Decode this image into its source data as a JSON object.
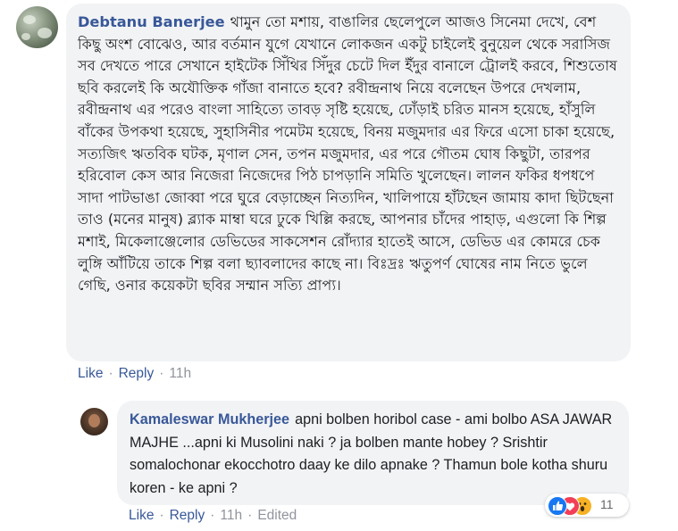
{
  "comment": {
    "author": "Debtanu Banerjee",
    "body": "থামুন তো মশায়, বাঙালির ছেলেপুলে আজও সিনেমা দেখে, বেশ কিছু অংশ বোঝেও, আর বর্তমান যুগে যেখানে লোকজন একটু চাইলেই বুনুয়েল থেকে সরাসিজ সব দেখতে পারে সেখানে হাইটেক সিঁথির সিঁদুর চেটে দিল ইঁদুর বানালে ট্রোলই করবে, শিশুতোষ ছবি করলেই কি অযৌক্তিক গাঁজা বানাতে হবে? রবীন্দ্রনাথ নিয়ে বলেছেন উপরে দেখলাম, রবীন্দ্রনাথ এর পরেও বাংলা সাহিত্যে তাবড় সৃষ্টি হয়েছে, ঢোঁড়াই চরিত মানস হয়েছে, হাঁসুলি বাঁকের উপকথা হয়েছে, সুহাসিনীর পমেটম হয়েছে, বিনয় মজুমদার এর ফিরে এসো চাকা হয়েছে, সত্যজিৎ ঋতবিক ঘটক, মৃণাল সেন, তপন মজুমদার, এর পরে গৌতম ঘোষ কিছুটা, তারপর হরিবোল কেস আর নিজেরা নিজেদের পিঠ চাপড়ানি সমিতি খুলেছেন। লালন ফকির ধপধপে সাদা পাটভাঙা জোব্বা পরে ঘুরে বেড়াচ্ছেন নিত্যদিন, খালিপায়ে হাঁটছেন জামায় কাদা ছিটছেনা তাও (মনের মানুষ) ব্ল্যাক মাম্বা ঘরে ঢুকে খিল্লি করছে, আপনার চাঁদের পাহাড়, এগুলো কি শিল্প মশাই, মিকেলাঞ্জেলোর ডেভিডের সাকসেশন রোঁদ্যার হাতেই আসে, ডেভিড এর কোমরে চেক লুঙ্গি আঁটিয়ে তাকে শিল্প বলা ছ্যাবলাদের কাছে না। বিঃদ্রঃ ঋতুপর্ণ ঘোষের নাম নিতে ভুলে গেছি, ওনার কয়েকটা ছবির সম্মান সত্যি প্রাপ্য।",
    "like_label": "Like",
    "reply_label": "Reply",
    "time": "11h"
  },
  "reply": {
    "author": "Kamaleswar Mukherjee",
    "body": "apni bolben horibol case - ami bolbo ASA JAWAR MAJHE ...apni ki Musolini naki ? ja bolben mante hobey ? Srishtir somalochonar ekocchotro daay ke dilo apnake ? Thamun bole kotha shuru koren - ke apni ?",
    "like_label": "Like",
    "reply_label": "Reply",
    "time": "11h",
    "edited_label": "Edited",
    "reaction_count": "11",
    "reactions": [
      "like-icon",
      "love-icon",
      "wow-icon"
    ]
  },
  "colors": {
    "link": "#385898",
    "bubble": "#f2f3f5",
    "meta": "#90949c"
  }
}
